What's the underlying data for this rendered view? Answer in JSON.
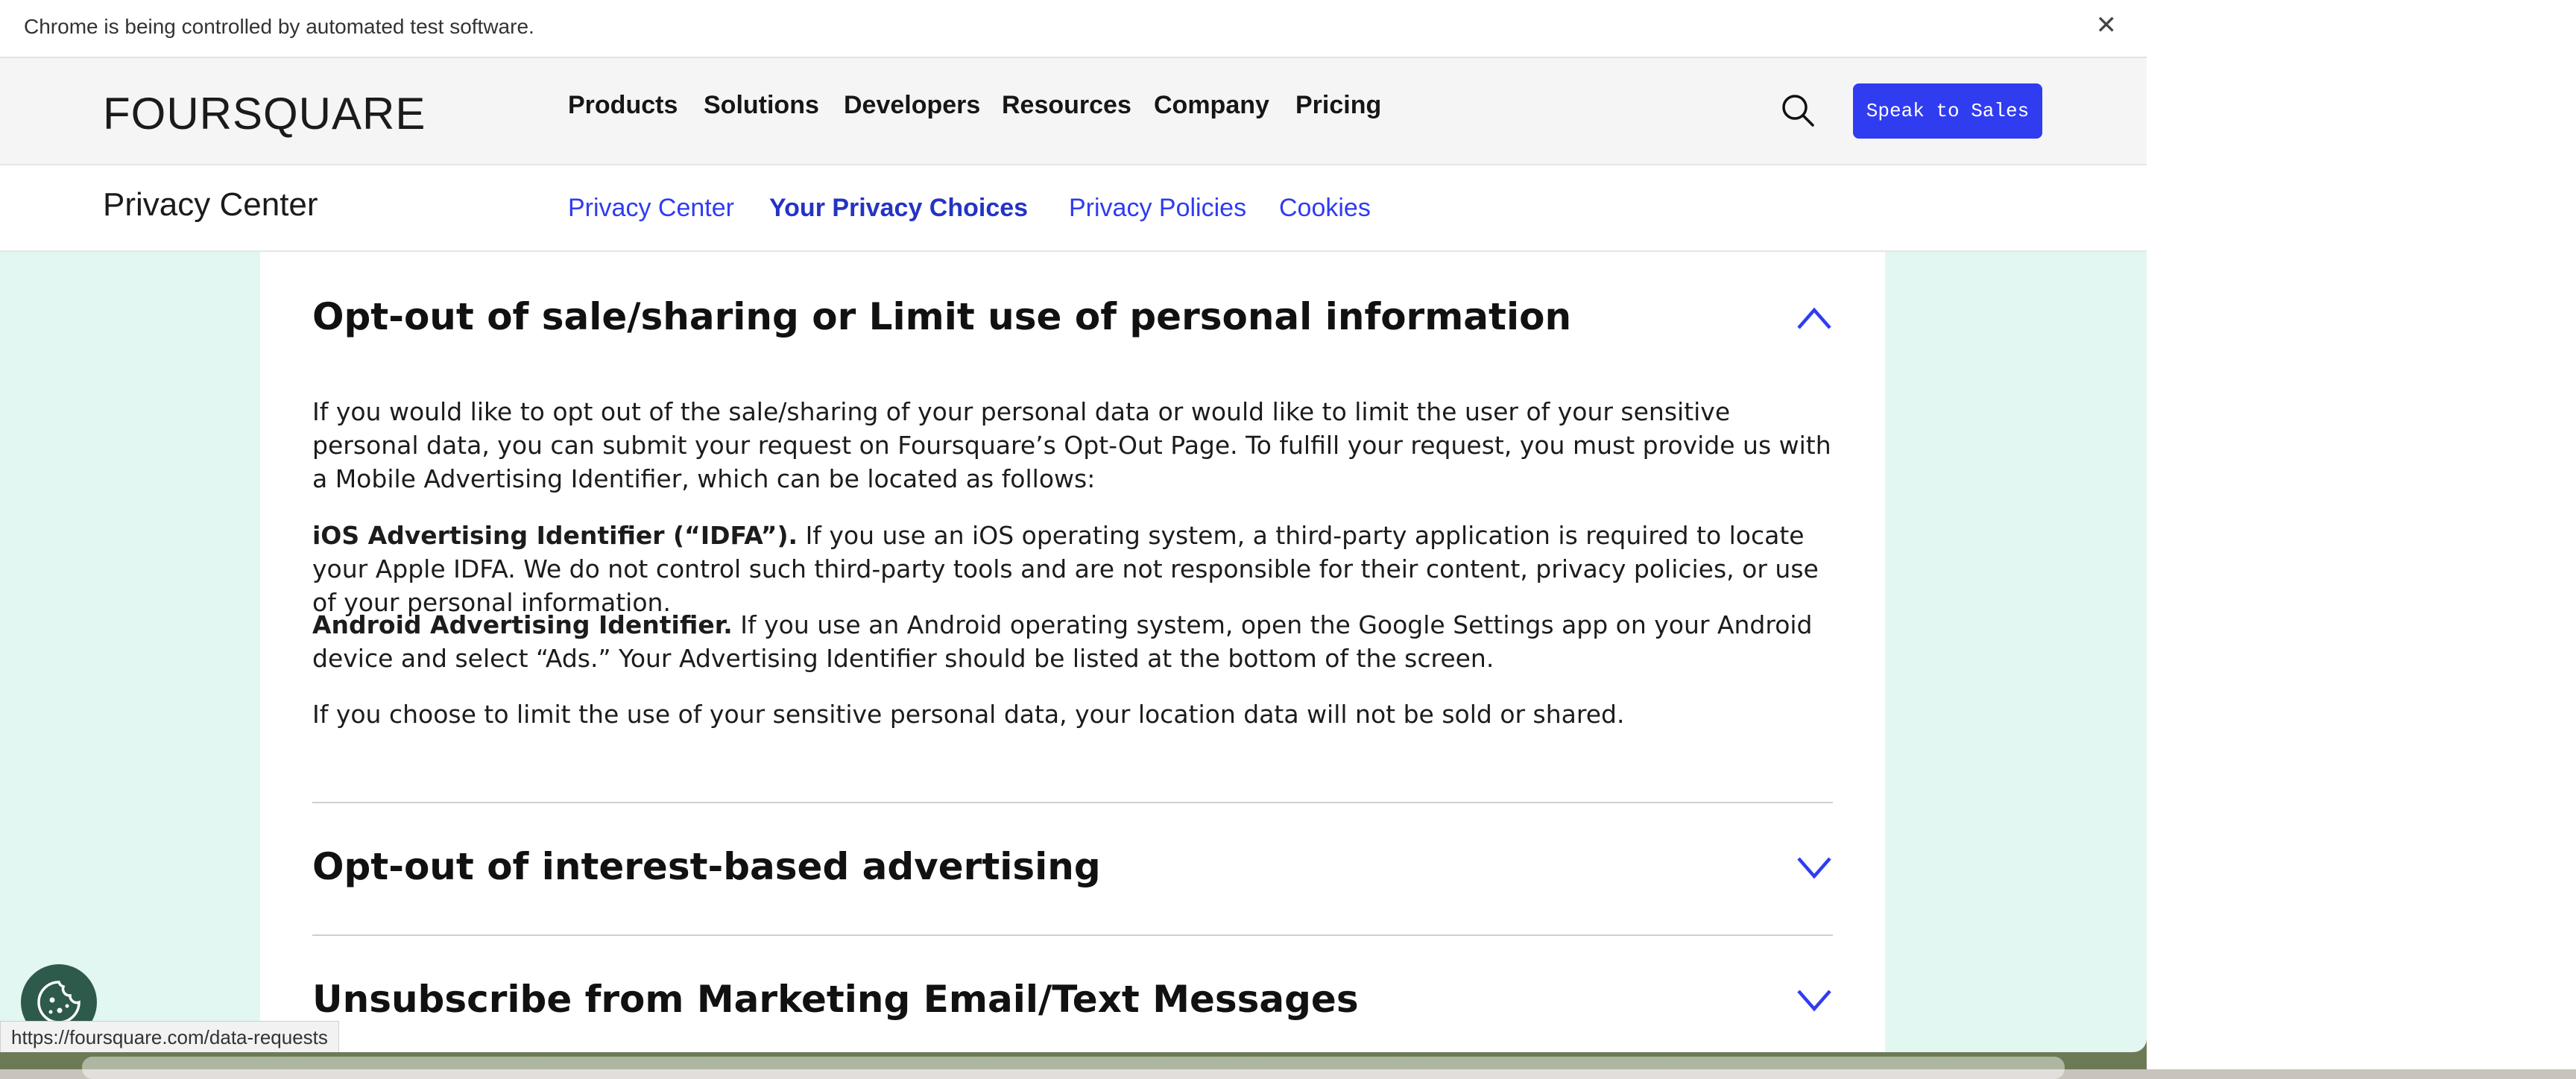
{
  "automation_bar": {
    "text": "Chrome is being controlled by automated test software.",
    "close_glyph": "✕"
  },
  "header": {
    "logo": "FOURSQUARE",
    "nav": [
      "Products",
      "Solutions",
      "Developers",
      "Resources",
      "Company",
      "Pricing"
    ],
    "speak_to_sales": "Speak to Sales"
  },
  "subnav": {
    "title": "Privacy Center",
    "links": [
      "Privacy Center",
      "Your Privacy Choices",
      "Privacy Policies",
      "Cookies"
    ],
    "active_index": 1
  },
  "content": {
    "section1": {
      "title": "Opt-out of sale/sharing or Limit use of personal information",
      "intro": "If you would like to opt out of the sale/sharing of your personal data or would like to limit the user of your sensitive personal data, you can submit your request on Foursquare’s Opt-Out Page. To fulfill your request, you must provide us with a Mobile Advertising Identifier, which can be located as follows:",
      "ios_label": "iOS Advertising Identifier (“IDFA”).",
      "ios_text": " If you use an iOS operating system, a third-party application is required to locate your Apple IDFA. We do not control such third-party tools and are not responsible for their content, privacy policies, or use of your personal information.",
      "android_label": "Android Advertising Identifier.",
      "android_text": " If you use an Android operating system, open the Google Settings app on your Android device and select “Ads.” Your Advertising Identifier should be listed at the bottom of the screen.",
      "limit_text": "If you choose to limit the use of your sensitive personal data, your location data will not be sold or shared."
    },
    "section2": {
      "title": "Opt-out of interest-based advertising"
    },
    "section3": {
      "title": "Unsubscribe from Marketing Email/Text Messages"
    }
  },
  "status_bar": {
    "url": "https://foursquare.com/data-requests"
  },
  "colors": {
    "accent": "#2f3cf0",
    "background": "#e2f6f2",
    "cookie_button": "#2d5a4a"
  }
}
